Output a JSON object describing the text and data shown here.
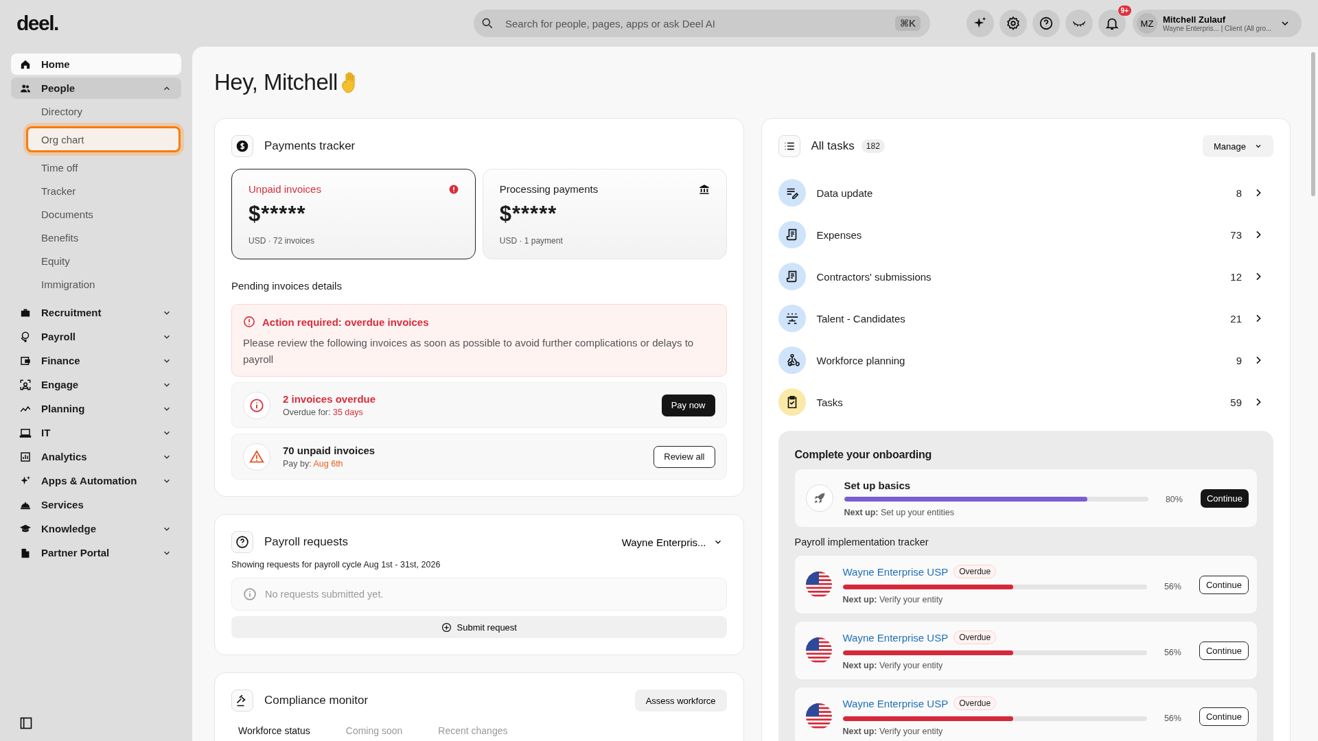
{
  "logo": "deel.",
  "search": {
    "placeholder": "Search for people, pages, apps or ask Deel AI",
    "shortcut": "⌘K"
  },
  "notifications": {
    "badge": "9+"
  },
  "profile": {
    "initials": "MZ",
    "name": "Mitchell Zulauf",
    "subtitle": "Wayne Enterpris... | Client (All gro..."
  },
  "sidebar": {
    "items": [
      {
        "label": "Home",
        "selected": true
      },
      {
        "label": "People",
        "selected": false,
        "expanded": true,
        "children": [
          {
            "label": "Directory",
            "highlighted": false
          },
          {
            "label": "Org chart",
            "highlighted": true
          },
          {
            "label": "Time off",
            "highlighted": false
          },
          {
            "label": "Tracker",
            "highlighted": false
          },
          {
            "label": "Documents",
            "highlighted": false
          },
          {
            "label": "Benefits",
            "highlighted": false
          },
          {
            "label": "Equity",
            "highlighted": false
          },
          {
            "label": "Immigration",
            "highlighted": false
          }
        ]
      },
      {
        "label": "Recruitment",
        "selected": false,
        "expanded": false
      },
      {
        "label": "Payroll",
        "selected": false,
        "expanded": false
      },
      {
        "label": "Finance",
        "selected": false,
        "expanded": false
      },
      {
        "label": "Engage",
        "selected": false,
        "expanded": false
      },
      {
        "label": "Planning",
        "selected": false,
        "expanded": false
      },
      {
        "label": "IT",
        "selected": false,
        "expanded": false
      },
      {
        "label": "Analytics",
        "selected": false,
        "expanded": false
      },
      {
        "label": "Apps & Automation",
        "selected": false,
        "expanded": false
      },
      {
        "label": "Services",
        "selected": false
      },
      {
        "label": "Knowledge",
        "selected": false,
        "expanded": false
      },
      {
        "label": "Partner Portal",
        "selected": false,
        "expanded": false
      }
    ]
  },
  "greeting": "Hey, Mitchell",
  "payments": {
    "title": "Payments tracker",
    "tiles": [
      {
        "kind": "alert",
        "label": "Unpaid invoices",
        "amount": "$*****",
        "meta": "USD · 72 invoices",
        "selected": true
      },
      {
        "kind": "bank",
        "label": "Processing payments",
        "amount": "$*****",
        "meta": "USD · 1 payment",
        "selected": false
      }
    ],
    "pending_title": "Pending invoices details",
    "alert": {
      "title": "Action required: overdue invoices",
      "body": "Please review the following invoices as soon as possible to avoid further complications or delays to payroll"
    },
    "items": [
      {
        "kind": "overdue",
        "title": "2 invoices overdue",
        "detail_label": "Overdue for:",
        "detail_value": "35 days",
        "button": "Pay now",
        "primary": true
      },
      {
        "kind": "unpaid",
        "title": "70 unpaid invoices",
        "detail_label": "Pay by:",
        "detail_value": "Aug 6th",
        "button": "Review all",
        "primary": false
      }
    ]
  },
  "payroll_requests": {
    "title": "Payroll requests",
    "entity": "Wayne Enterpris...",
    "subtitle": "Showing requests for payroll cycle Aug 1st - 31st, 2026",
    "empty": "No requests submitted yet.",
    "button": "Submit request"
  },
  "compliance": {
    "title": "Compliance monitor",
    "button": "Assess workforce",
    "tabs": [
      {
        "label": "Workforce status",
        "selected": true
      },
      {
        "label": "Coming soon",
        "selected": false
      },
      {
        "label": "Recent changes",
        "selected": false
      }
    ]
  },
  "tasks": {
    "title": "All tasks",
    "count": "182",
    "manage": "Manage",
    "rows": [
      {
        "label": "Data update",
        "count": "8",
        "color": "#cfe3fb"
      },
      {
        "label": "Expenses",
        "count": "73",
        "color": "#cfe3fb"
      },
      {
        "label": "Contractors' submissions",
        "count": "12",
        "color": "#cfe3fb"
      },
      {
        "label": "Talent - Candidates",
        "count": "21",
        "color": "#cfe3fb"
      },
      {
        "label": "Workforce planning",
        "count": "9",
        "color": "#cfe3fb"
      },
      {
        "label": "Tasks",
        "count": "59",
        "color": "#fbe9a8"
      }
    ]
  },
  "onboarding": {
    "title": "Complete your onboarding",
    "step": {
      "title": "Set up basics",
      "level": 0.8,
      "percent": "80%",
      "next_label": "Next up:",
      "next": "Set up your entities",
      "button": "Continue"
    },
    "tracker_title": "Payroll implementation tracker",
    "entries": [
      {
        "name": "Wayne Enterprise USP",
        "status": "Overdue",
        "level": 0.56,
        "percent": "56%",
        "next_label": "Next up:",
        "next": "Verify your entity",
        "button": "Continue"
      },
      {
        "name": "Wayne Enterprise USP",
        "status": "Overdue",
        "level": 0.56,
        "percent": "56%",
        "next_label": "Next up:",
        "next": "Verify your entity",
        "button": "Continue"
      },
      {
        "name": "Wayne Enterprise USP",
        "status": "Overdue",
        "level": 0.56,
        "percent": "56%",
        "next_label": "Next up:",
        "next": "Verify your entity",
        "button": "Continue"
      }
    ]
  }
}
